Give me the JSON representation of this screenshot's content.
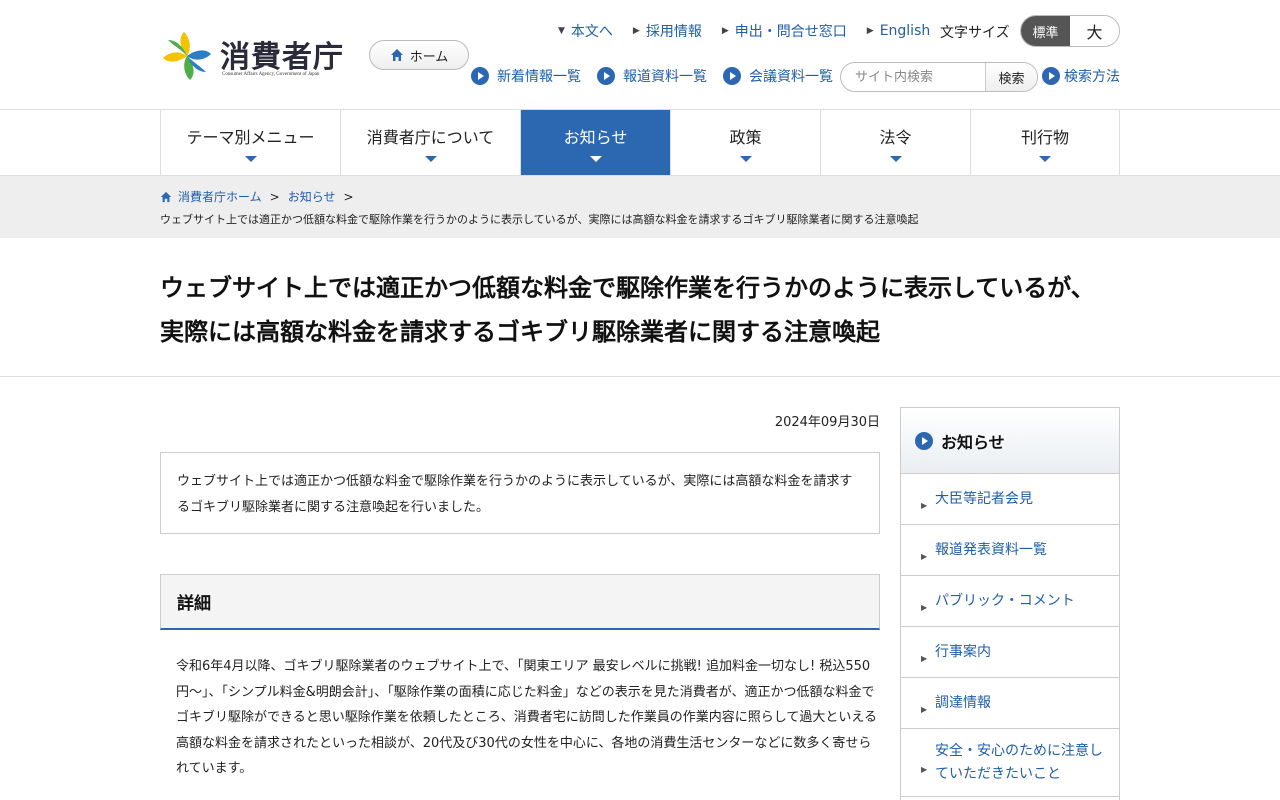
{
  "header": {
    "logo_text": "消費者庁",
    "logo_sub": "Consumer Affairs Agency, Government of Japan",
    "home_label": "ホーム",
    "util_links": [
      {
        "label": "本文へ",
        "marker": "down"
      },
      {
        "label": "採用情報",
        "marker": "right"
      },
      {
        "label": "申出・問合せ窓口",
        "marker": "right"
      },
      {
        "label": "English",
        "marker": "right"
      }
    ],
    "font_size_label": "文字サイズ",
    "font_size_standard": "標準",
    "font_size_large": "大",
    "sub_links": [
      "新着情報一覧",
      "報道資料一覧",
      "会議資料一覧"
    ],
    "search_placeholder": "サイト内検索",
    "search_button": "検索",
    "search_help": "検索方法"
  },
  "gnav": [
    {
      "label": "テーマ別メニュー",
      "active": false
    },
    {
      "label": "消費者庁について",
      "active": false
    },
    {
      "label": "お知らせ",
      "active": true
    },
    {
      "label": "政策",
      "active": false
    },
    {
      "label": "法令",
      "active": false
    },
    {
      "label": "刊行物",
      "active": false
    }
  ],
  "breadcrumb": {
    "home": "消費者庁ホーム",
    "section": "お知らせ",
    "sep": ">",
    "current": "ウェブサイト上では適正かつ低額な料金で駆除作業を行うかのように表示しているが、実際には高額な料金を請求するゴキブリ駆除業者に関する注意喚起"
  },
  "page": {
    "title_line1": "ウェブサイト上では適正かつ低額な料金で駆除作業を行うかのように表示しているが、",
    "title_line2": "実際には高額な料金を請求するゴキブリ駆除業者に関する注意喚起",
    "date": "2024年09月30日",
    "summary": "ウェブサイト上では適正かつ低額な料金で駆除作業を行うかのように表示しているが、実際には高額な料金を請求するゴキブリ駆除業者に関する注意喚起を行いました。",
    "detail_heading": "詳細",
    "detail_body": "令和6年4月以降、ゴキブリ駆除業者のウェブサイト上で、「関東エリア 最安レベルに挑戦! 追加料金一切なし! 税込550円～」、「シンプル料金&明朗会計」、「駆除作業の面積に応じた料金」などの表示を見た消費者が、適正かつ低額な料金でゴキブリ駆除ができると思い駆除作業を依頼したところ、消費者宅に訪問した作業員の作業内容に照らして過大といえる高額な料金を請求されたといった相談が、20代及び30代の女性を中心に、各地の消費生活センターなどに数多く寄せられています。"
  },
  "sidebar": {
    "heading": "お知らせ",
    "items": [
      "大臣等記者会見",
      "報道発表資料一覧",
      "パブリック・コメント",
      "行事案内",
      "調達情報",
      "安全・安心のために注意していただきたいこと"
    ]
  },
  "colors": {
    "accent": "#2c67b1",
    "link": "#1f5ea8",
    "logo_yellow": "#f2c300",
    "logo_green": "#4fae48",
    "logo_blue": "#2c7fc6"
  },
  "icons": {
    "home": "home-icon",
    "link_marker": "circle-arrow-icon",
    "nav_caret": "caret-down-icon"
  }
}
